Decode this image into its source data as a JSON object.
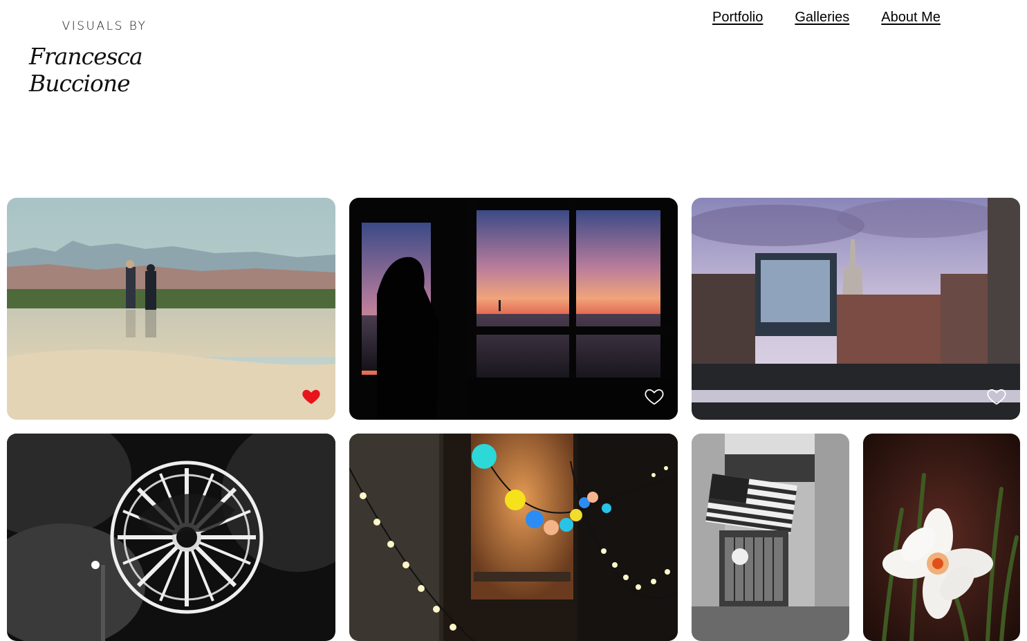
{
  "brand": {
    "line1": "VISUALS BY",
    "line2": "Francesca Buccione"
  },
  "nav": {
    "items": [
      {
        "label": "Portfolio"
      },
      {
        "label": "Galleries"
      },
      {
        "label": "About Me"
      }
    ]
  },
  "photos": [
    {
      "subject": "beach-reflection",
      "favorited": true
    },
    {
      "subject": "statue-of-liberty-sunset-window",
      "favorited": false
    },
    {
      "subject": "empire-state-skyline",
      "favorited": false
    },
    {
      "subject": "ferris-wheel-night-bw"
    },
    {
      "subject": "string-lights-window"
    },
    {
      "subject": "flag-building-bw"
    },
    {
      "subject": "white-daffodil"
    }
  ],
  "colors": {
    "favorite_active": "#e8141c",
    "favorite_outline": "#ffffff",
    "text": "#000000"
  },
  "icons": {
    "favorite": "heart-icon"
  }
}
